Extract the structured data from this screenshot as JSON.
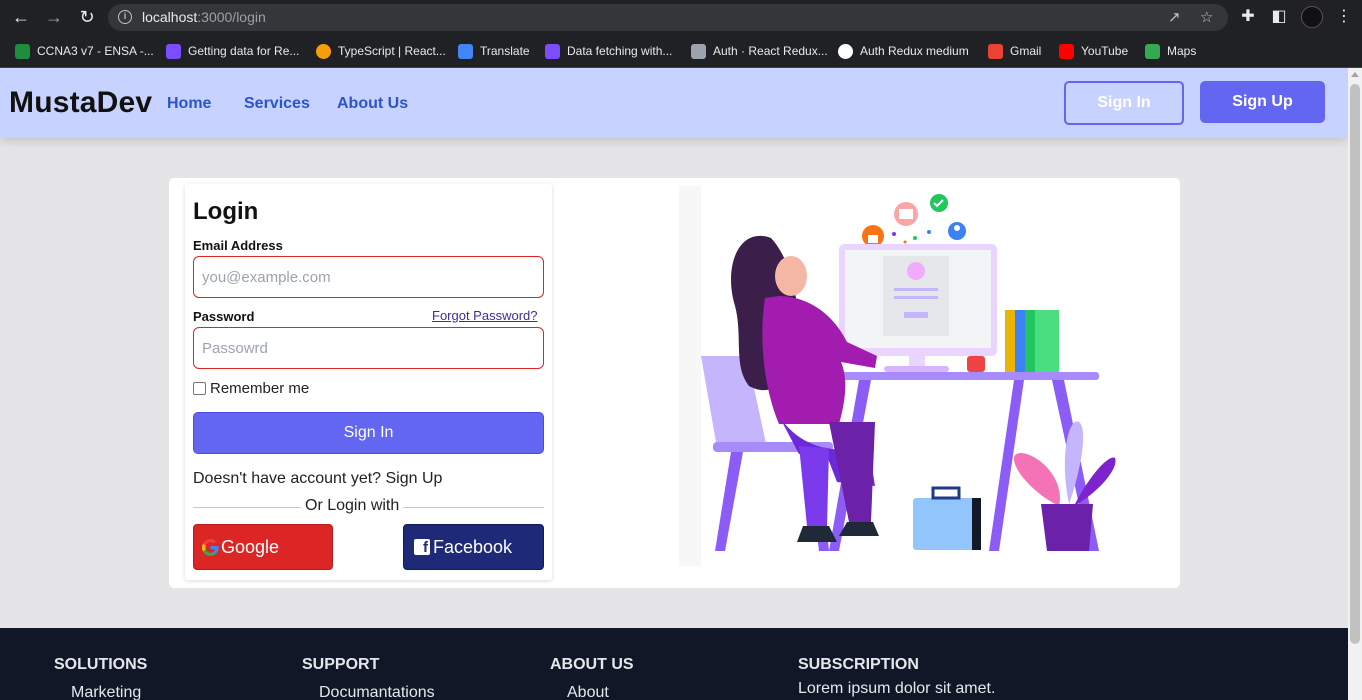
{
  "browser": {
    "url_host": "localhost",
    "url_rest": ":3000/login",
    "bookmarks": [
      {
        "label": "CCNA3 v7 - ENSA -...",
        "color": "#1e8e3e"
      },
      {
        "label": "Getting data for Re...",
        "color": "#7c4dff"
      },
      {
        "label": "TypeScript | React...",
        "color": "#f59e0b"
      },
      {
        "label": "Translate",
        "color": "#4285f4"
      },
      {
        "label": "Data fetching with...",
        "color": "#7c4dff"
      },
      {
        "label": "Auth · React Redux...",
        "color": "#9ca3af"
      },
      {
        "label": "Auth Redux medium",
        "color": "#ffffff"
      },
      {
        "label": "Gmail",
        "color": "#ea4335"
      },
      {
        "label": "YouTube",
        "color": "#ff0000"
      },
      {
        "label": "Maps",
        "color": "#34a853"
      }
    ]
  },
  "navbar": {
    "brand": "MustaDev",
    "links": [
      "Home",
      "Services",
      "About Us"
    ],
    "signin_label": "Sign In",
    "signup_label": "Sign Up"
  },
  "login": {
    "title": "Login",
    "email_label": "Email Address",
    "email_placeholder": "you@example.com",
    "password_label": "Password",
    "forgot_label": "Forgot Password?",
    "password_placeholder": "Passowrd",
    "remember_label": "Remember me",
    "submit_label": "Sign In",
    "signup_prompt": "Doesn't have account yet? Sign Up",
    "or_label": "Or Login with",
    "google_label": "Google",
    "facebook_label": "Facebook"
  },
  "footer": {
    "columns": [
      {
        "heading": "SOLUTIONS",
        "first_item": "Marketing"
      },
      {
        "heading": "SUPPORT",
        "first_item": "Documantations"
      },
      {
        "heading": "ABOUT US",
        "first_item": "About"
      },
      {
        "heading": "SUBSCRIPTION",
        "first_item": "Lorem ipsum dolor sit amet."
      }
    ]
  },
  "colors": {
    "accent": "#6366f1",
    "navbar_bg": "#c7d2fe",
    "google": "#dc2626",
    "facebook": "#1e2a78",
    "footer_bg": "#101828"
  }
}
